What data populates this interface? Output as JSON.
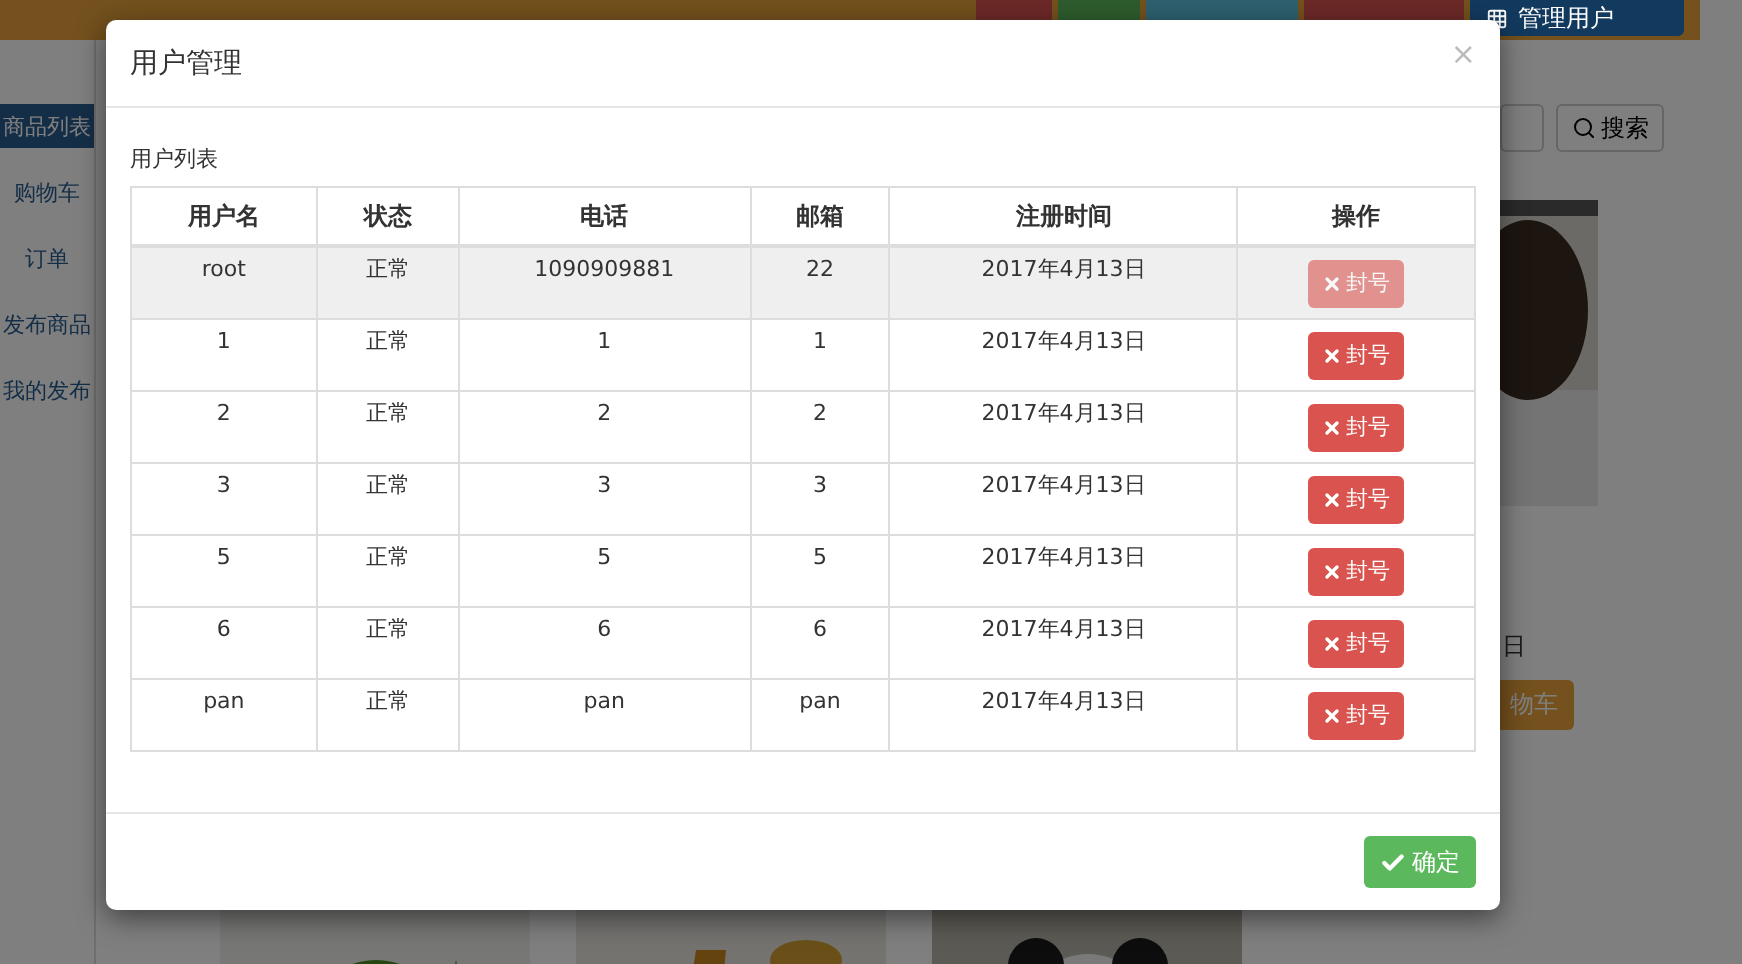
{
  "navbar": {
    "buttons": [
      {
        "color": "#6c2927"
      },
      {
        "color": "#2e5c2e"
      },
      {
        "color": "#2d606f"
      },
      {
        "color": "#6c2927"
      },
      {
        "label": "管理用户",
        "color": "#123a5e"
      }
    ]
  },
  "sidebar": {
    "items": [
      {
        "label": "商品列表",
        "selected": true
      },
      {
        "label": "购物车",
        "selected": false
      },
      {
        "label": "订单",
        "selected": false
      },
      {
        "label": "发布商品",
        "selected": false
      },
      {
        "label": "我的发布",
        "selected": false
      }
    ]
  },
  "search": {
    "button": "搜索"
  },
  "product_row_1": [
    {
      "kind": "picture",
      "date": "日",
      "cart_button": "物车"
    }
  ],
  "modal": {
    "title": "用户管理",
    "close": "×",
    "section_label": "用户列表",
    "table": {
      "columns": [
        "用户名",
        "状态",
        "电话",
        "邮箱",
        "注册时间",
        "操作"
      ],
      "rows": [
        {
          "hovered": true,
          "cells": [
            "root",
            "正常",
            "1090909881",
            "22",
            "2017年4月13日"
          ],
          "action": {
            "label": "封号",
            "disabled": true
          }
        },
        {
          "hovered": false,
          "cells": [
            "1",
            "正常",
            "1",
            "1",
            "2017年4月13日"
          ],
          "action": {
            "label": "封号",
            "disabled": false
          }
        },
        {
          "hovered": false,
          "cells": [
            "2",
            "正常",
            "2",
            "2",
            "2017年4月13日"
          ],
          "action": {
            "label": "封号",
            "disabled": false
          }
        },
        {
          "hovered": false,
          "cells": [
            "3",
            "正常",
            "3",
            "3",
            "2017年4月13日"
          ],
          "action": {
            "label": "封号",
            "disabled": false
          }
        },
        {
          "hovered": false,
          "cells": [
            "5",
            "正常",
            "5",
            "5",
            "2017年4月13日"
          ],
          "action": {
            "label": "封号",
            "disabled": false
          }
        },
        {
          "hovered": false,
          "cells": [
            "6",
            "正常",
            "6",
            "6",
            "2017年4月13日"
          ],
          "action": {
            "label": "封号",
            "disabled": false
          }
        },
        {
          "hovered": false,
          "cells": [
            "pan",
            "正常",
            "pan",
            "pan",
            "2017年4月13日"
          ],
          "action": {
            "label": "封号",
            "disabled": false
          }
        }
      ]
    },
    "confirm_button": "确定"
  }
}
